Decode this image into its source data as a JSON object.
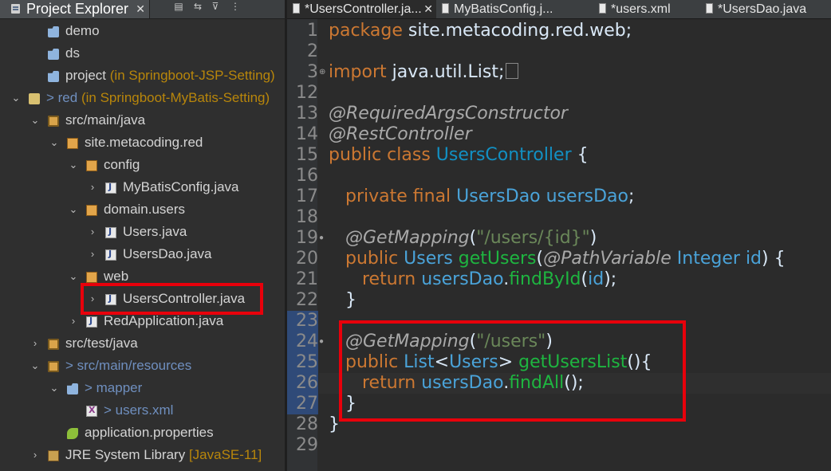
{
  "explorer": {
    "tab_label": "Project Explorer",
    "close_glyph": "✕",
    "toolbar_icons": [
      "collapse-all-icon",
      "link-with-editor-icon",
      "filter-icon",
      "view-menu-icon"
    ],
    "tree": [
      {
        "label": "demo",
        "decoration": "",
        "icon": "folder-icon",
        "twist": ""
      },
      {
        "label": "ds",
        "decoration": "",
        "icon": "folder-icon",
        "twist": ""
      },
      {
        "label": "project",
        "decoration": "(in Springboot-JSP-Setting)",
        "icon": "folder-icon",
        "twist": ""
      },
      {
        "label": "> red",
        "decoration": "(in Springboot-MyBatis-Setting)",
        "icon": "project-icon",
        "twist": "⌄"
      },
      {
        "label": "src/main/java",
        "decoration": "",
        "icon": "source-folder-icon",
        "twist": "⌄"
      },
      {
        "label": "site.metacoding.red",
        "decoration": "",
        "icon": "package-icon",
        "twist": "⌄"
      },
      {
        "label": "config",
        "decoration": "",
        "icon": "package-icon",
        "twist": "⌄"
      },
      {
        "label": "MyBatisConfig.java",
        "decoration": "",
        "icon": "java-file-icon",
        "twist": "›"
      },
      {
        "label": "domain.users",
        "decoration": "",
        "icon": "package-icon",
        "twist": "⌄"
      },
      {
        "label": "Users.java",
        "decoration": "",
        "icon": "java-file-icon",
        "twist": "›"
      },
      {
        "label": "UsersDao.java",
        "decoration": "",
        "icon": "java-file-icon",
        "twist": "›"
      },
      {
        "label": "web",
        "decoration": "",
        "icon": "package-icon",
        "twist": "⌄"
      },
      {
        "label": "UsersController.java",
        "decoration": "",
        "icon": "java-file-icon",
        "twist": "›"
      },
      {
        "label": "RedApplication.java",
        "decoration": "",
        "icon": "java-file-icon",
        "twist": "›"
      },
      {
        "label": "src/test/java",
        "decoration": "",
        "icon": "source-folder-icon",
        "twist": "›"
      },
      {
        "label": "> src/main/resources",
        "decoration": "",
        "icon": "source-folder-icon",
        "twist": "⌄"
      },
      {
        "label": "> mapper",
        "decoration": "",
        "icon": "folder-icon",
        "twist": "⌄"
      },
      {
        "label": "> users.xml",
        "decoration": "",
        "icon": "xml-file-icon",
        "twist": ""
      },
      {
        "label": "application.properties",
        "decoration": "",
        "icon": "properties-file-icon",
        "twist": ""
      },
      {
        "label": "JRE System Library",
        "decoration": "[JavaSE-11]",
        "icon": "library-icon",
        "twist": "›"
      }
    ]
  },
  "editor": {
    "tabs": [
      {
        "label": "*UsersController.ja...",
        "active": true,
        "icon": "java-file-icon"
      },
      {
        "label": "MyBatisConfig.j...",
        "active": false,
        "icon": "java-file-icon"
      },
      {
        "label": "*users.xml",
        "active": false,
        "icon": "xml-file-icon"
      },
      {
        "label": "*UsersDao.java",
        "active": false,
        "icon": "java-file-icon"
      }
    ],
    "tab_close_glyph": "✕",
    "lines": [
      {
        "num": "1",
        "tokens": [
          [
            "kw",
            "package "
          ],
          [
            "plain",
            "site.metacoding.red.web;"
          ]
        ]
      },
      {
        "num": "2",
        "tokens": []
      },
      {
        "num": "3",
        "tokens": [
          [
            "kw",
            "import "
          ],
          [
            "plain",
            "java.util.List;"
          ]
        ],
        "fold": "⊕",
        "folded_box": true
      },
      {
        "num": "12",
        "tokens": []
      },
      {
        "num": "13",
        "tokens": [
          [
            "annot",
            "@RequiredArgsConstructor"
          ]
        ]
      },
      {
        "num": "14",
        "tokens": [
          [
            "annot",
            "@RestController"
          ]
        ]
      },
      {
        "num": "15",
        "tokens": [
          [
            "kw",
            "public class "
          ],
          [
            "cls",
            "UsersController"
          ],
          [
            "plain",
            " {"
          ]
        ]
      },
      {
        "num": "16",
        "tokens": []
      },
      {
        "num": "17",
        "tokens": [
          [
            "plain",
            "   "
          ],
          [
            "kw",
            "private final "
          ],
          [
            "typ",
            "UsersDao "
          ],
          [
            "typ",
            "usersDao"
          ],
          [
            "plain",
            ";"
          ]
        ]
      },
      {
        "num": "18",
        "tokens": []
      },
      {
        "num": "19",
        "tokens": [
          [
            "plain",
            "   "
          ],
          [
            "annot",
            "@GetMapping"
          ],
          [
            "plain",
            "("
          ],
          [
            "str",
            "\"/users/{id}\""
          ],
          [
            "plain",
            ")"
          ]
        ],
        "fold": "●"
      },
      {
        "num": "20",
        "tokens": [
          [
            "plain",
            "   "
          ],
          [
            "kw",
            "public "
          ],
          [
            "typ",
            "Users "
          ],
          [
            "fn",
            "getUsers"
          ],
          [
            "plain",
            "("
          ],
          [
            "annot",
            "@PathVariable "
          ],
          [
            "typ",
            "Integer "
          ],
          [
            "typ",
            "id"
          ],
          [
            "plain",
            ") {"
          ]
        ]
      },
      {
        "num": "21",
        "tokens": [
          [
            "plain",
            "      "
          ],
          [
            "kw",
            "return "
          ],
          [
            "typ",
            "usersDao"
          ],
          [
            "plain",
            "."
          ],
          [
            "fn",
            "findById"
          ],
          [
            "plain",
            "("
          ],
          [
            "typ",
            "id"
          ],
          [
            "plain",
            ");"
          ]
        ]
      },
      {
        "num": "22",
        "tokens": [
          [
            "plain",
            "   }"
          ]
        ]
      },
      {
        "num": "23",
        "tokens": [],
        "selected": true
      },
      {
        "num": "24",
        "tokens": [
          [
            "plain",
            "   "
          ],
          [
            "annot",
            "@GetMapping"
          ],
          [
            "plain",
            "("
          ],
          [
            "str",
            "\"/users\""
          ],
          [
            "plain",
            ")"
          ]
        ],
        "fold": "●",
        "selected": true
      },
      {
        "num": "25",
        "tokens": [
          [
            "plain",
            "   "
          ],
          [
            "kw",
            "public "
          ],
          [
            "typ",
            "List"
          ],
          [
            "plain",
            "<"
          ],
          [
            "typ",
            "Users"
          ],
          [
            "plain",
            "> "
          ],
          [
            "fn",
            "getUsersList"
          ],
          [
            "plain",
            "(){"
          ]
        ],
        "selected": true
      },
      {
        "num": "26",
        "tokens": [
          [
            "plain",
            "      "
          ],
          [
            "kw",
            "return "
          ],
          [
            "typ",
            "usersDao"
          ],
          [
            "plain",
            "."
          ],
          [
            "fn",
            "findAll"
          ],
          [
            "plain",
            "();"
          ]
        ],
        "selected": true,
        "current": true
      },
      {
        "num": "27",
        "tokens": [
          [
            "plain",
            "   }"
          ]
        ],
        "selected": true
      },
      {
        "num": "28",
        "tokens": [
          [
            "plain",
            "}"
          ]
        ]
      },
      {
        "num": "29",
        "tokens": []
      }
    ]
  }
}
